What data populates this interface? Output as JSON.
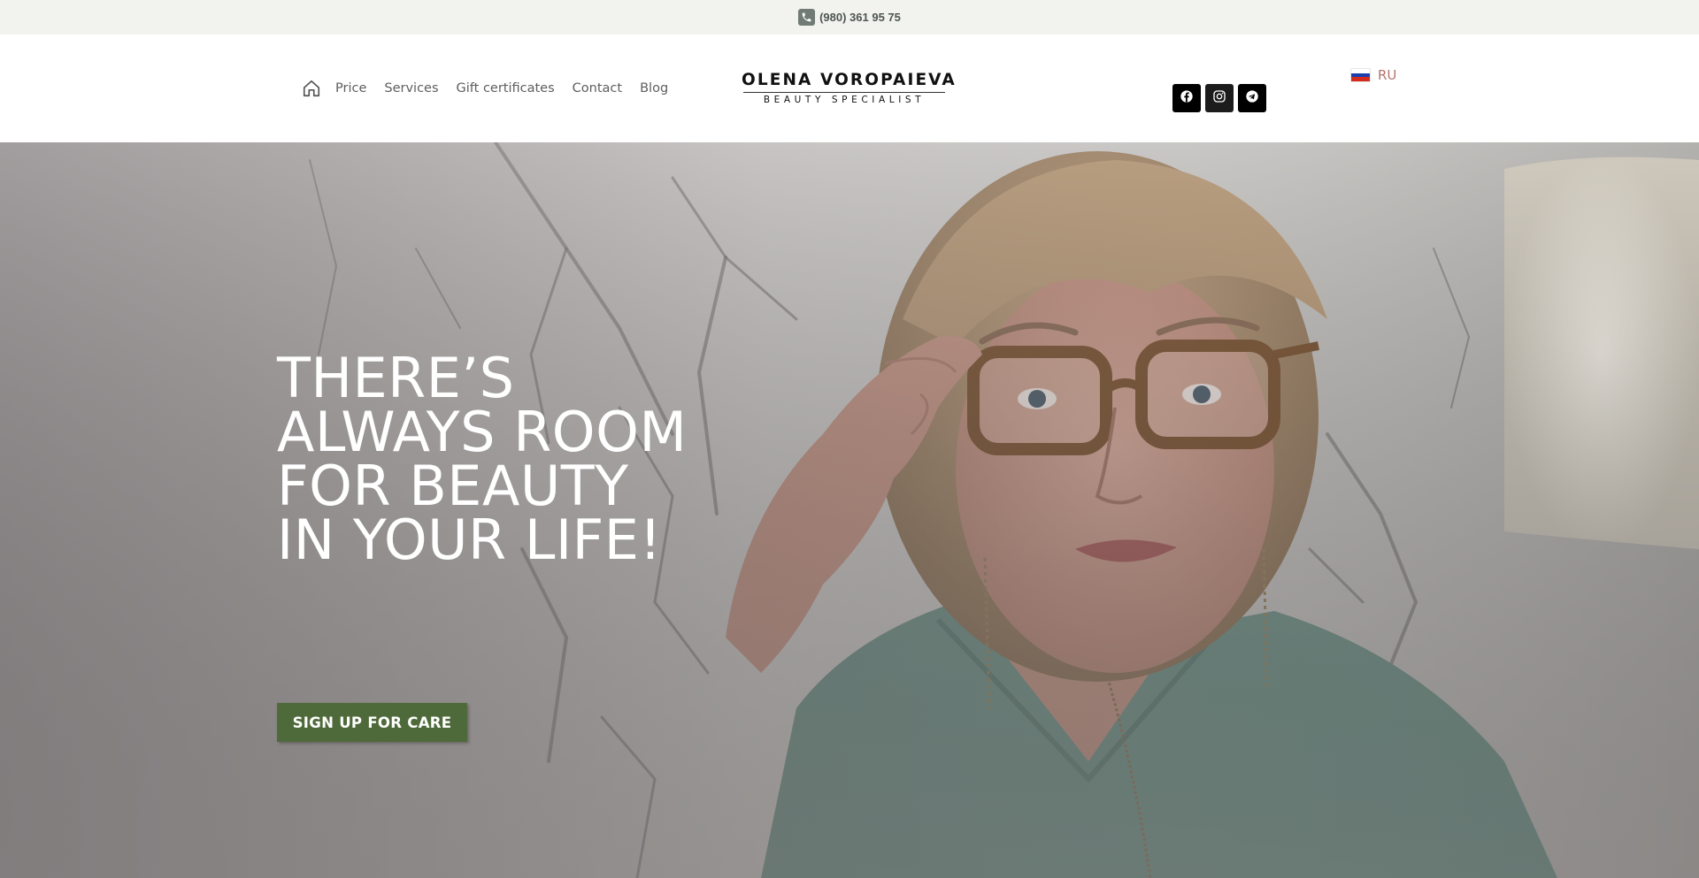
{
  "topbar": {
    "phone": "(980) 361 95 75",
    "phone_icon": "phone-icon"
  },
  "nav": {
    "home_icon": "home-icon",
    "items": [
      {
        "label": "Price"
      },
      {
        "label": "Services"
      },
      {
        "label": "Gift certificates"
      },
      {
        "label": "Contact"
      },
      {
        "label": "Blog"
      }
    ]
  },
  "logo": {
    "name": "OLENA VOROPAIEVA",
    "subtitle": "BEAUTY SPECIALIST"
  },
  "social": [
    {
      "icon": "facebook-icon"
    },
    {
      "icon": "instagram-icon"
    },
    {
      "icon": "telegram-icon"
    }
  ],
  "language": {
    "code": "RU",
    "flag_icon": "russia-flag-icon"
  },
  "hero": {
    "headline": "THERE’S\nALWAYS ROOM\nFOR BEAUTY\nIN YOUR LIFE!",
    "cta_label": "SIGN UP FOR CARE"
  },
  "colors": {
    "topbar_bg": "#f2f2ee",
    "cta_bg": "#4f6a3a",
    "lang_text": "#b5736c",
    "social_bg": "#000000"
  }
}
